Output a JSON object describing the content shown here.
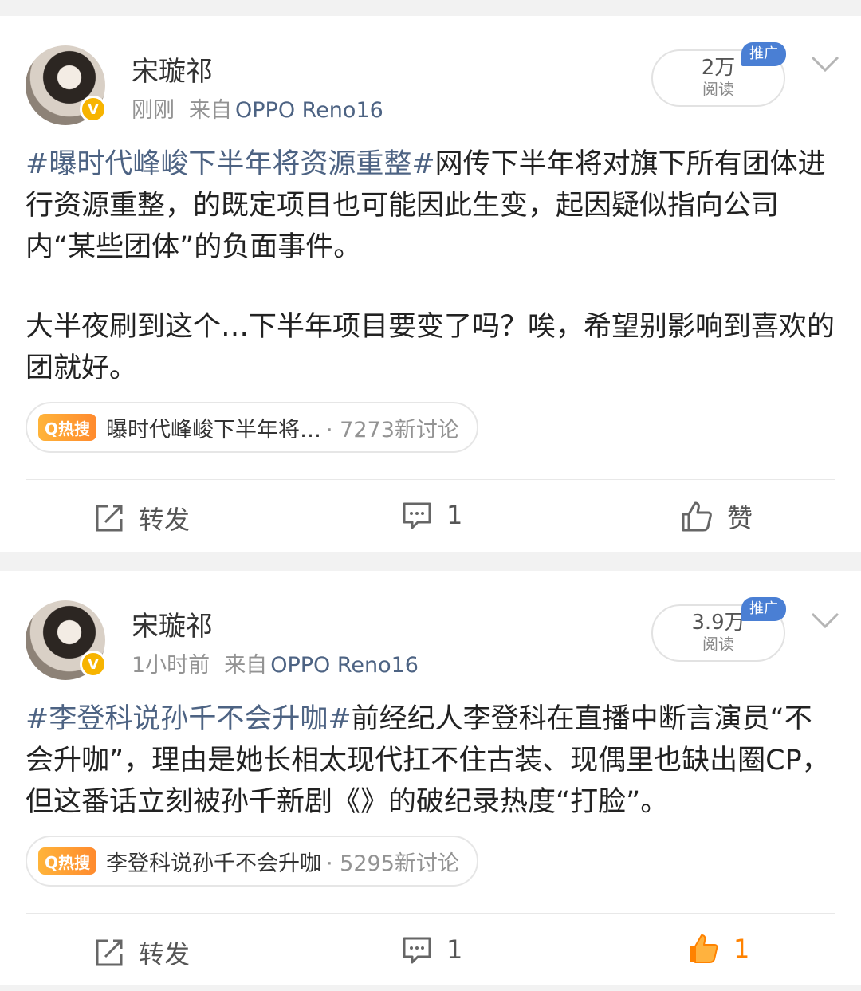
{
  "posts": [
    {
      "user": {
        "name": "宋璇祁",
        "verified_icon": "v-badge-icon"
      },
      "time": "刚刚",
      "source_prefix": "来自",
      "device": "OPPO Reno16",
      "reads": {
        "count": "2万",
        "label": "阅读"
      },
      "promo_badge": "推广",
      "hashtag": "#曝时代峰峻下半年将资源重整#",
      "text1": "网传下半年将对旗下所有团体进行资源重整，的既定项目也可能因此生变，起因疑似指向公司内“某些团体”的负面事件。",
      "text2": "大半夜刷到这个…下半年项目要变了吗？唉，希望别影响到喜欢的团就好。",
      "hot_search": {
        "label": "Q热搜",
        "topic": "曝时代峰峻下半年将…",
        "count": "· 7273新讨论"
      },
      "actions": {
        "repost": "转发",
        "comment": "1",
        "like": "赞"
      }
    },
    {
      "user": {
        "name": "宋璇祁",
        "verified_icon": "v-badge-icon"
      },
      "time": "1小时前",
      "source_prefix": "来自",
      "device": "OPPO Reno16",
      "reads": {
        "count": "3.9万",
        "label": "阅读"
      },
      "promo_badge": "推广",
      "hashtag": "#李登科说孙千不会升咖#",
      "text1": "前经纪人李登科在直播中断言演员“不会升咖”，理由是她长相太现代扛不住古装、现偶里也缺出圈CP，但这番话立刻被孙千新剧《》的破纪录热度“打脸”。",
      "hot_search": {
        "label": "Q热搜",
        "topic": "李登科说孙千不会升咖",
        "count": "· 5295新讨论"
      },
      "actions": {
        "repost": "转发",
        "comment": "1",
        "like": "1"
      }
    }
  ],
  "colors": {
    "link": "#4d6383",
    "like_active": "#ff8200",
    "hot_badge": "#ff9a33",
    "promo": "#4a7fd4"
  }
}
